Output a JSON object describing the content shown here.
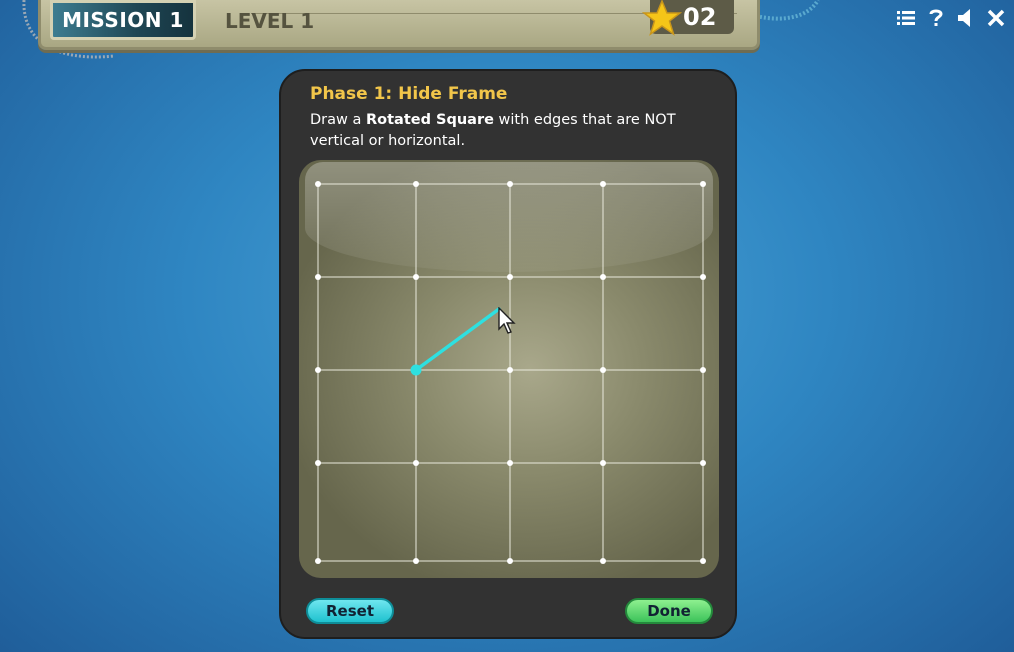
{
  "hud": {
    "mission_label": "MISSION 1",
    "level_label": "LEVEL 1",
    "star_count": "02",
    "icons": [
      "list-icon",
      "help-icon",
      "sound-icon",
      "close-icon"
    ]
  },
  "panel": {
    "title": "Phase 1: Hide Frame",
    "desc_prefix": "Draw a ",
    "desc_bold": "Rotated Square",
    "desc_suffix": " with edges that are NOT vertical or horizontal.",
    "grid": {
      "columns": 5,
      "rows": 5,
      "drawn_segment": {
        "from_point": {
          "col": 1,
          "row": 2
        },
        "toward": "cursor"
      }
    },
    "reset_label": "Reset",
    "done_label": "Done"
  },
  "colors": {
    "accent_title": "#f2c64a",
    "segment": "#2ee0e0",
    "reset": "#1fc2cf",
    "done": "#3cc35a",
    "background": "#2f86c2"
  }
}
